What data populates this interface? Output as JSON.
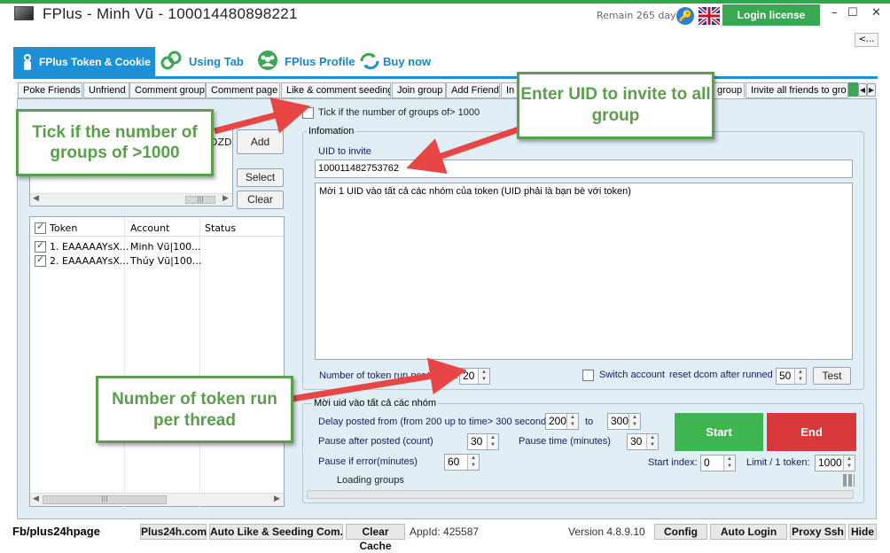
{
  "window": {
    "title": "FPlus - Minh Vũ - 100014480898221",
    "remain": "Remain 265 days",
    "login_license": "Login license",
    "minimize": "–",
    "maximize": "☐",
    "close": "✕",
    "back": "<..."
  },
  "nav": [
    {
      "label": "FPlus Token & Cookie"
    },
    {
      "label": "Using Tab"
    },
    {
      "label": "FPlus Profile"
    },
    {
      "label": "Buy now"
    }
  ],
  "tabs": [
    "Poke Friends",
    "Unfriend",
    "Comment group",
    "Comment page",
    "Like & comment seeding",
    "Join group",
    "Add Friend",
    "In",
    "group",
    "Invite all friends to gro"
  ],
  "left": {
    "partial_text": "DZD",
    "add": "Add",
    "select": "Select",
    "clear": "Clear",
    "columns": [
      "Token",
      "Account",
      "Status"
    ],
    "rows": [
      {
        "token": "1. EAAAAAYsX...",
        "account": "Minh Vũ|100...",
        "status": ""
      },
      {
        "token": "2. EAAAAAYsX...",
        "account": "Thúy Vũ|100...",
        "status": ""
      }
    ]
  },
  "main": {
    "tick_label": "Tick if the number of groups of> 1000",
    "info_legend": "Infomation",
    "uid_label": "UID to invite",
    "uid_value": "100011482753762",
    "desc": "Mời 1 UID vào tất cả các nhóm của token (UID phải là bạn bè với token)",
    "threads_label": "Number of token run per thread:",
    "threads_value": "20",
    "switch_label": "Switch account",
    "reset_label": "reset dcom after runned",
    "reset_value": "50",
    "test": "Test",
    "legend2": "Mời uid vào tất cả các nhóm",
    "delay_label": "Delay posted from (from 200 up to time> 300 seconds)",
    "delay_from": "200",
    "to": "to",
    "delay_to": "300",
    "pause_after_label": "Pause after posted (count)",
    "pause_after": "30",
    "pause_time_label": "Pause time (minutes)",
    "pause_time": "30",
    "pause_error_label": "Pause if error(minutes)",
    "pause_error": "60",
    "start_index_label": "Start index:",
    "start_index": "0",
    "limit_label": "Limit / 1 token:",
    "limit": "1000",
    "loading": "Loading groups",
    "start": "Start",
    "end": "End"
  },
  "callouts": {
    "tick": "Tick if the number of groups of >1000",
    "uid": "Enter UID to invite to all group",
    "threads": "Number of token run per thread"
  },
  "bottom": {
    "fb": "Fb/plus24hpage",
    "site": "Plus24h.com",
    "seeding": "Auto Like & Seeding Com...",
    "clear_cache": "Clear Cache",
    "appid": "AppId: 425587",
    "version": "Version 4.8.9.10",
    "config": "Config",
    "auto_login": "Auto Login",
    "proxy": "Proxy Ssh",
    "hide": "Hide"
  },
  "colors": {
    "accent": "#1e90d6",
    "green": "#3aa752",
    "red": "#d9383a",
    "callout": "#5aa04a",
    "arrow": "#e84545"
  }
}
